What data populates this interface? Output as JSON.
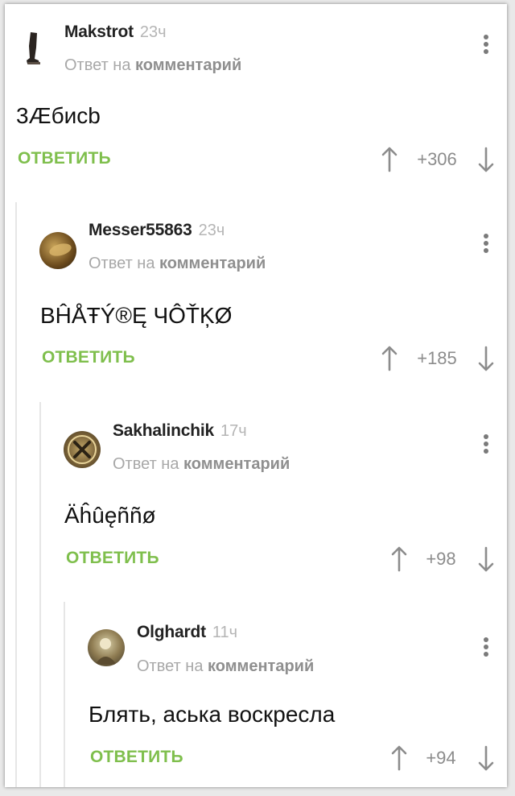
{
  "comments": [
    {
      "username": "Makstrot",
      "time": "23ч",
      "reply_prefix": "Ответ на",
      "reply_link": "комментарий",
      "text": "3Æбисb",
      "reply_label": "ответить",
      "score": "+306",
      "avatar": "boot-avatar"
    },
    {
      "username": "Messer55863",
      "time": "23ч",
      "reply_prefix": "Ответ на",
      "reply_link": "комментарий",
      "text": "BĤÅŦÝ®Ę ЧÔŤĶØ",
      "reply_label": "ответить",
      "score": "+185",
      "avatar": "gold-coin-avatar"
    },
    {
      "username": "Sakhalinchik",
      "time": "17ч",
      "reply_prefix": "Ответ на",
      "reply_link": "комментарий",
      "text": "Äĥûęññø",
      "reply_label": "ответить",
      "score": "+98",
      "avatar": "emblem-avatar"
    },
    {
      "username": "Olghardt",
      "time": "11ч",
      "reply_prefix": "Ответ на",
      "reply_link": "комментарий",
      "text": "Блять, аська воскресла",
      "reply_label": "ответить",
      "score": "+94",
      "avatar": "photo-avatar"
    }
  ],
  "colors": {
    "reply_button": "#7fbf4d",
    "score": "#8c8c8c",
    "meta": "#a8a8a8",
    "thread_line": "#e6e6e6"
  }
}
